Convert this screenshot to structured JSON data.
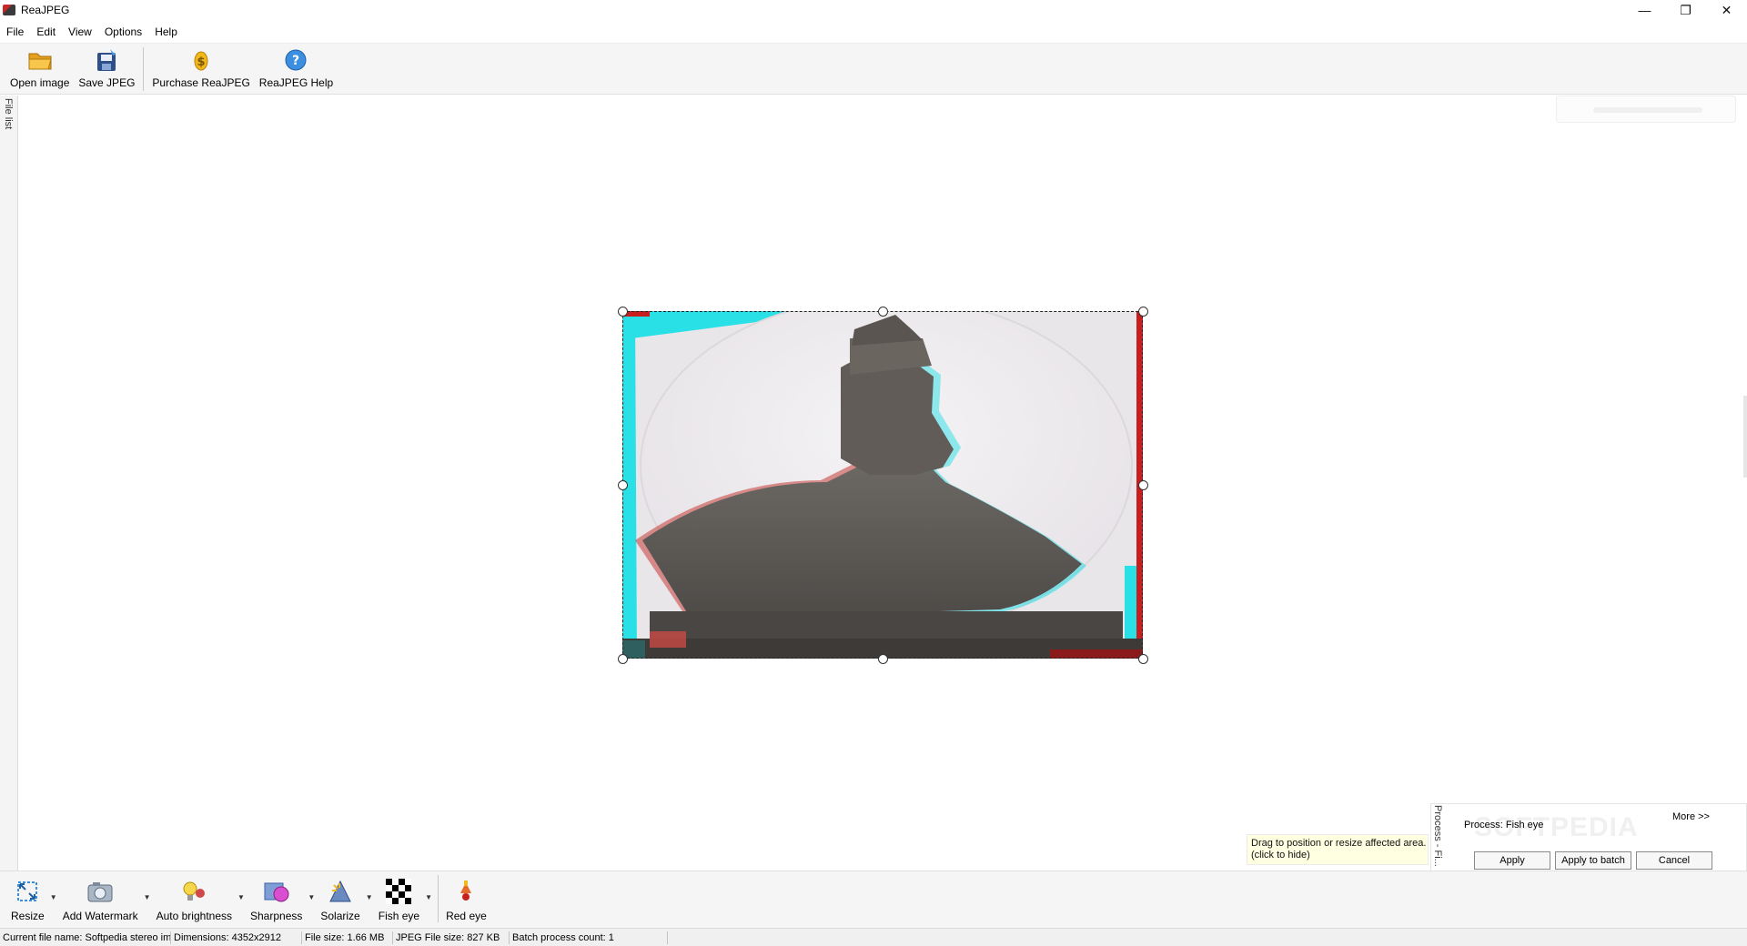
{
  "window": {
    "title": "ReaJPEG",
    "minimize": "—",
    "restore": "❐",
    "close": "✕"
  },
  "menu": [
    "File",
    "Edit",
    "View",
    "Options",
    "Help"
  ],
  "toolbar": [
    {
      "label": "Open image",
      "icon": "folder-icon"
    },
    {
      "label": "Save JPEG",
      "icon": "save-icon"
    },
    {
      "label": "Purchase ReaJPEG",
      "icon": "purchase-icon"
    },
    {
      "label": "ReaJPEG Help",
      "icon": "help-icon"
    }
  ],
  "side_tab": "File list",
  "tooltip": {
    "line1": "Drag to position or resize affected area.",
    "line2": "(click to hide)"
  },
  "process_panel": {
    "tab": "Process - Fi...",
    "title": "Process: Fish eye",
    "more": "More >>",
    "watermark": "SOFTPEDIA",
    "apply": "Apply",
    "apply_batch": "Apply to batch",
    "cancel": "Cancel"
  },
  "bottom_tools": [
    {
      "label": "Resize",
      "icon": "resize-icon",
      "dropdown": true
    },
    {
      "label": "Add Watermark",
      "icon": "watermark-icon",
      "dropdown": true
    },
    {
      "label": "Auto brightness",
      "icon": "brightness-icon",
      "dropdown": true
    },
    {
      "label": "Sharpness",
      "icon": "sharpness-icon",
      "dropdown": true
    },
    {
      "label": "Solarize",
      "icon": "solarize-icon",
      "dropdown": true
    },
    {
      "label": "Fish eye",
      "icon": "fisheye-icon",
      "dropdown": true
    },
    {
      "label": "Red eye",
      "icon": "redeye-icon",
      "dropdown": false
    }
  ],
  "status": {
    "file_name": "Current file name:  Softpedia stereo im",
    "dimensions": "Dimensions:  4352x2912",
    "file_size": "File size:  1.66 MB",
    "jpeg_size": "JPEG File size:  827 KB",
    "batch": "Batch process count:  1"
  },
  "colors": {
    "toolbar_bg": "#f5f5f5",
    "tooltip_bg": "#ffffe1",
    "anaglyph_cyan": "#28e0e6",
    "anaglyph_red": "#c81e1e"
  }
}
